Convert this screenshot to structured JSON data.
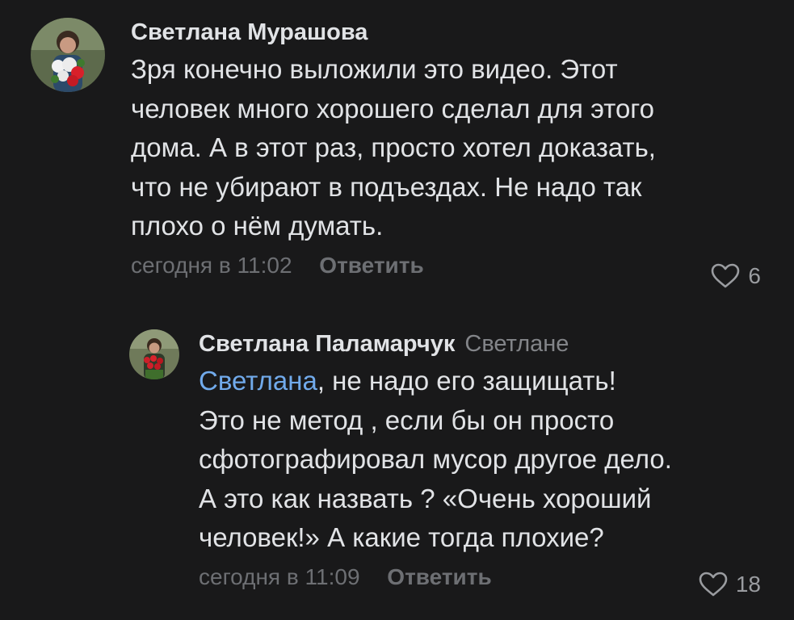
{
  "comments": [
    {
      "author": "Светлана Мурашова",
      "reply_to": "",
      "mention": "",
      "text_lines": [
        "Зря конечно выложили это видео. Этот",
        "человек много хорошего сделал для этого",
        "дома. А в этот раз, просто хотел доказать,",
        "что не убирают в подъездах. Не надо так",
        "плохо о нём думать."
      ],
      "timestamp": "сегодня в 11:02",
      "reply_label": "Ответить",
      "likes": "6",
      "avatar_icon": "avatar-woman-with-flowers"
    },
    {
      "author": "Светлана Паламарчук",
      "reply_to": "Светлане",
      "mention": "Светлана",
      "first_line_rest": ", не надо его защищать!",
      "text_lines": [
        "Это не метод , если бы он просто",
        "сфотографировал мусор другое дело.",
        "А это как назвать ? «Очень хороший",
        "человек!» А какие тогда плохие?"
      ],
      "timestamp": "сегодня в 11:09",
      "reply_label": "Ответить",
      "likes": "18",
      "avatar_icon": "avatar-woman-with-roses"
    }
  ],
  "colors": {
    "background": "#19191a",
    "text": "#e1e3e6",
    "secondary": "#6d6f73",
    "link": "#71aaeb"
  }
}
